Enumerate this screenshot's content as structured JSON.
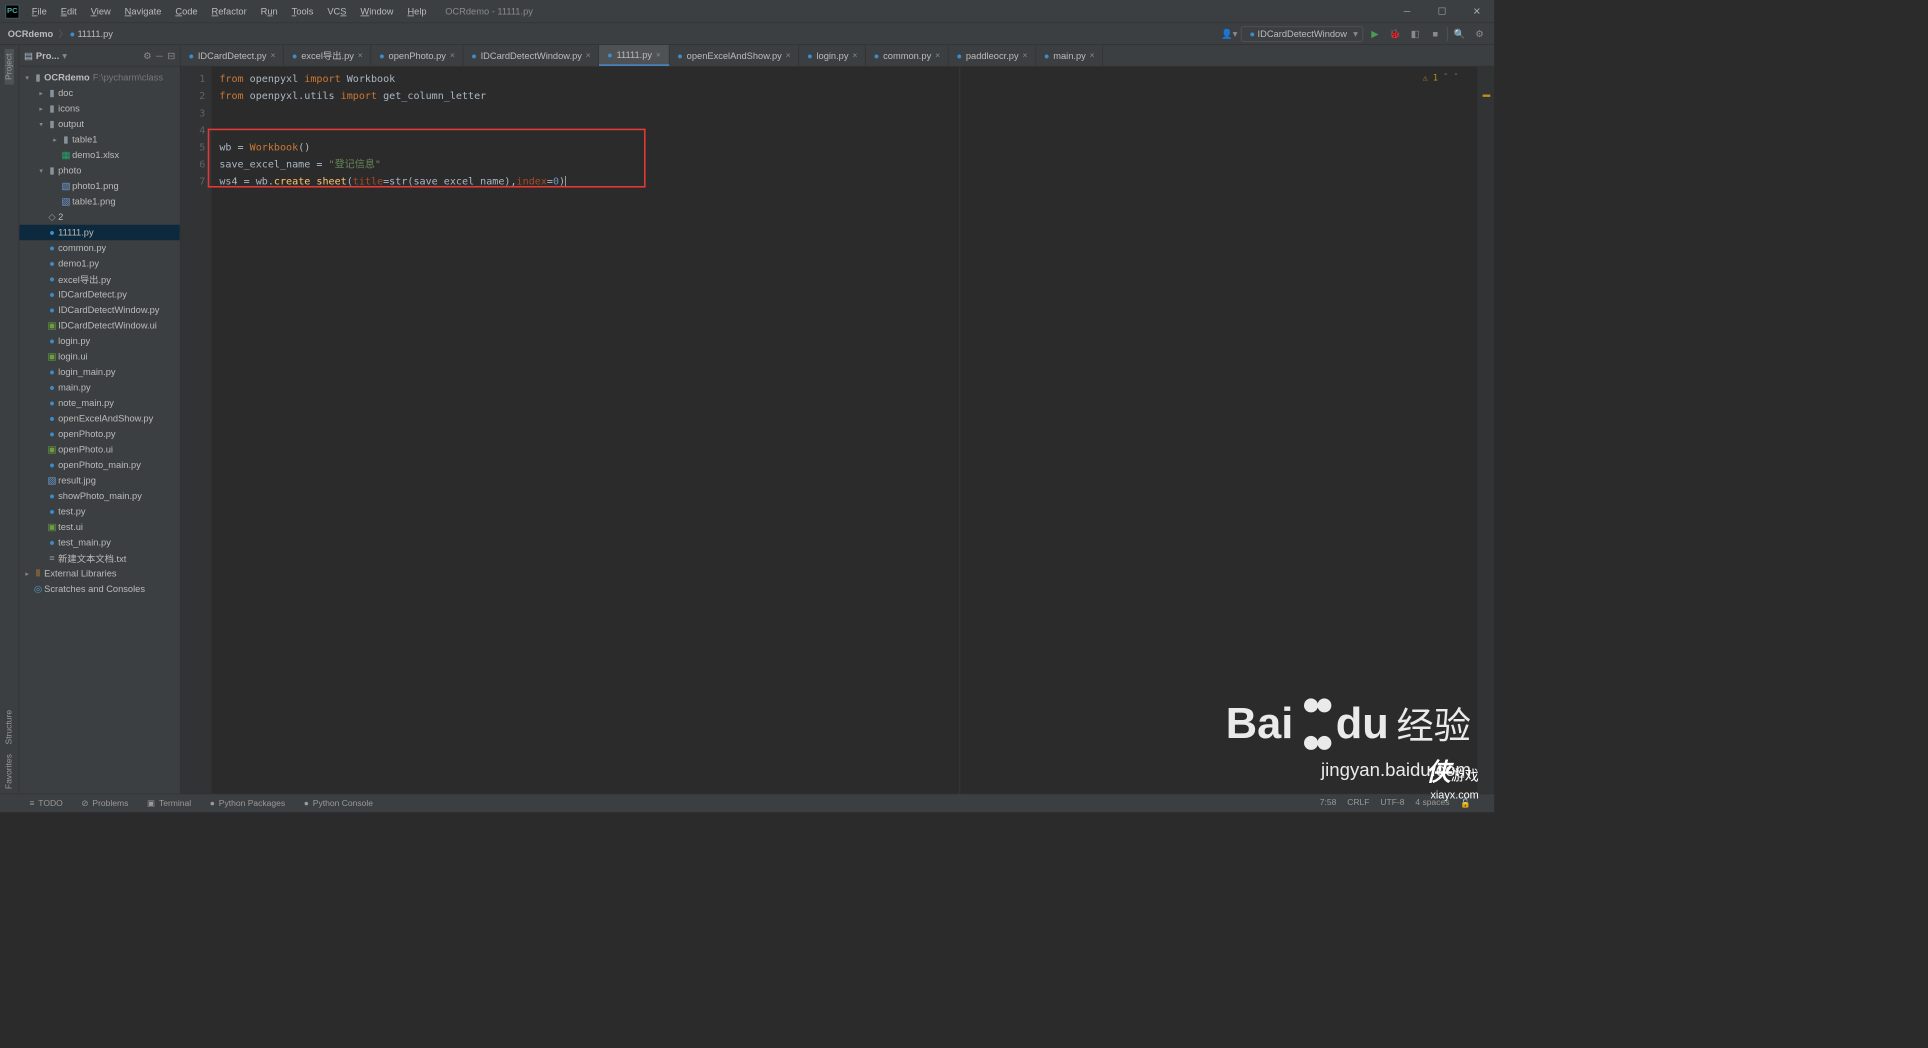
{
  "window": {
    "title": "OCRdemo - 11111.py"
  },
  "menus": [
    "File",
    "Edit",
    "View",
    "Navigate",
    "Code",
    "Refactor",
    "Run",
    "Tools",
    "VCS",
    "Window",
    "Help"
  ],
  "breadcrumb": {
    "root": "OCRdemo",
    "file": "11111.py"
  },
  "run_config": "IDCardDetectWindow",
  "project_title": "Pro...",
  "tree": {
    "root": "OCRdemo",
    "root_path": "F:\\pycharm\\class",
    "folders": {
      "doc": "doc",
      "icons": "icons",
      "output": "output",
      "table1": "table1",
      "photo": "photo"
    },
    "files": {
      "demo1x": "demo1.xlsx",
      "photo1": "photo1.png",
      "table1p": "table1.png",
      "two": "2",
      "f11111": "11111.py",
      "common": "common.py",
      "demo1": "demo1.py",
      "excel": "excel导出.py",
      "idcd": "IDCardDetect.py",
      "idcdw": "IDCardDetectWindow.py",
      "idcdwu": "IDCardDetectWindow.ui",
      "login": "login.py",
      "loginui": "login.ui",
      "loginm": "login_main.py",
      "main": "main.py",
      "notem": "note_main.py",
      "openex": "openExcelAndShow.py",
      "openph": "openPhoto.py",
      "openphu": "openPhoto.ui",
      "openphm": "openPhoto_main.py",
      "result": "result.jpg",
      "showpm": "showPhoto_main.py",
      "test": "test.py",
      "testui": "test.ui",
      "testm": "test_main.py",
      "newtxt": "新建文本文档.txt",
      "ext": "External Libraries",
      "scratch": "Scratches and Consoles"
    }
  },
  "tabs": [
    {
      "label": "IDCardDetect.py"
    },
    {
      "label": "excel导出.py"
    },
    {
      "label": "openPhoto.py"
    },
    {
      "label": "IDCardDetectWindow.py"
    },
    {
      "label": "11111.py",
      "active": true
    },
    {
      "label": "openExcelAndShow.py"
    },
    {
      "label": "login.py"
    },
    {
      "label": "common.py"
    },
    {
      "label": "paddleocr.py"
    },
    {
      "label": "main.py"
    }
  ],
  "gutter_lines": [
    "1",
    "2",
    "3",
    "4",
    "5",
    "6",
    "7"
  ],
  "code": {
    "l1": {
      "kw1": "from",
      "m1": " openpyxl ",
      "kw2": "import",
      "m2": " Workbook"
    },
    "l2": {
      "kw1": "from",
      "m1": " openpyxl.utils ",
      "kw2": "import",
      "m2": " get_column_letter"
    },
    "l5": {
      "v": "wb = ",
      "cls": "Workbook",
      "p": "()"
    },
    "l6": {
      "v": "save_excel_name = ",
      "s": "\"登记信息\""
    },
    "l7": {
      "v": "ws4 = wb.",
      "fn": "create_sheet",
      "p1": "(",
      "k1": "title",
      "e1": "=str(save_excel_name),",
      "k2": "index",
      "e2": "=",
      "n": "0",
      "p2": ")"
    }
  },
  "warning": "1",
  "status": {
    "pos": "7:58",
    "le": "CRLF",
    "enc": "UTF-8",
    "indent": "4 spaces"
  },
  "bottom_tabs": [
    "TODO",
    "Problems",
    "Terminal",
    "Python Packages",
    "Python Console"
  ],
  "left_tabs": {
    "project": "Project",
    "structure": "Structure",
    "favorites": "Favorites"
  },
  "watermark": {
    "brand_en": "Bai",
    "brand_en2": "du",
    "brand_cn": "经验",
    "url": "jingyan.baidu.com",
    "logo2": "侠",
    "logo2sub": "xiayx.com",
    "logo2cn": "游戏"
  }
}
